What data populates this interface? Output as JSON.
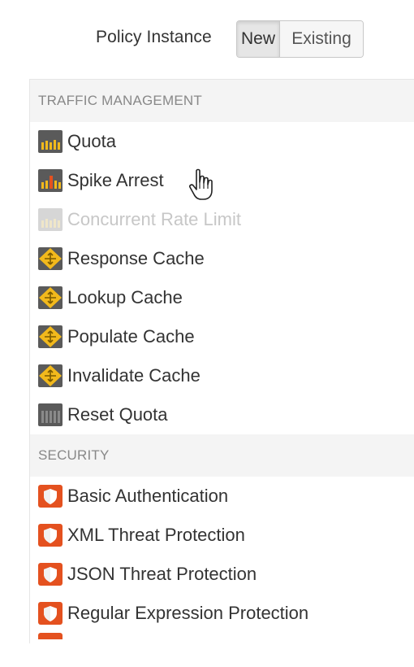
{
  "header": {
    "label": "Policy Instance",
    "toggle": {
      "new": "New",
      "existing": "Existing",
      "selected": "New"
    }
  },
  "sections": [
    {
      "title": "TRAFFIC MANAGEMENT",
      "items": [
        {
          "label": "Quota",
          "icon": "quota-icon",
          "disabled": false
        },
        {
          "label": "Spike Arrest",
          "icon": "spike-arrest-icon",
          "disabled": false
        },
        {
          "label": "Concurrent Rate Limit",
          "icon": "concurrent-rate-limit-icon",
          "disabled": true
        },
        {
          "label": "Response Cache",
          "icon": "cache-icon",
          "disabled": false
        },
        {
          "label": "Lookup Cache",
          "icon": "cache-icon",
          "disabled": false
        },
        {
          "label": "Populate Cache",
          "icon": "cache-icon",
          "disabled": false
        },
        {
          "label": "Invalidate Cache",
          "icon": "cache-icon",
          "disabled": false
        },
        {
          "label": "Reset Quota",
          "icon": "reset-quota-icon",
          "disabled": false
        }
      ]
    },
    {
      "title": "SECURITY",
      "items": [
        {
          "label": "Basic Authentication",
          "icon": "shield-icon",
          "disabled": false
        },
        {
          "label": "XML Threat Protection",
          "icon": "shield-icon",
          "disabled": false
        },
        {
          "label": "JSON Threat Protection",
          "icon": "shield-icon",
          "disabled": false
        },
        {
          "label": "Regular Expression Protection",
          "icon": "shield-icon",
          "disabled": false
        }
      ]
    }
  ],
  "colors": {
    "cache": "#f2b91c",
    "shield": "#e4511f",
    "quota_bg": "#5a5a5a",
    "section_bg": "#f4f4f4"
  }
}
